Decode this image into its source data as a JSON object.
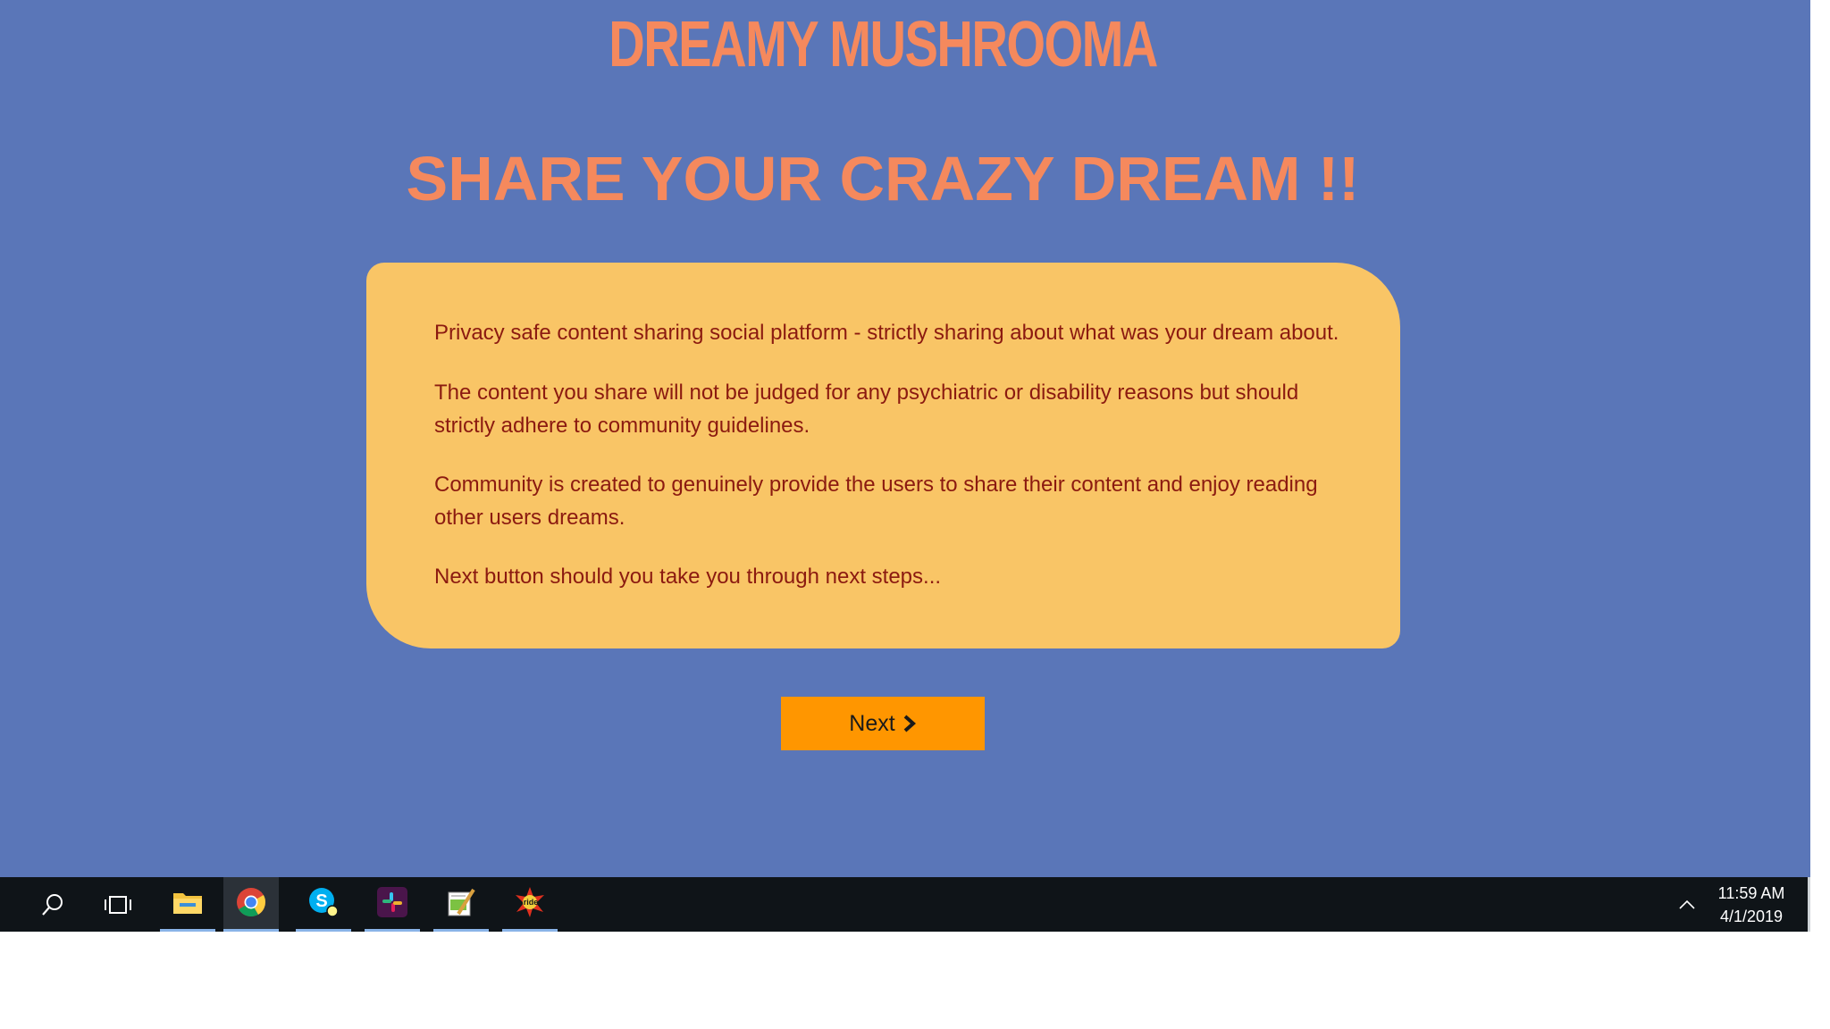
{
  "site": {
    "title": "DREAMY MUSHROOMA",
    "heading": "SHARE YOUR CRAZY DREAM !!"
  },
  "card": {
    "paragraphs": [
      "Privacy safe content sharing social platform - strictly sharing about what was your dream about.",
      "The content you share will not be judged for any psychiatric or disability reasons but should strictly adhere to community guidelines.",
      "Community is created to genuinely provide the users to share their content and enjoy reading other users dreams.",
      "Next button should you take you through next steps..."
    ]
  },
  "next_button": {
    "label": "Next",
    "icon": "chevron-right-icon"
  },
  "taskbar": {
    "time": "11:59 AM",
    "date": "4/1/2019",
    "apps": [
      {
        "name": "file-explorer",
        "icon": "folder-icon"
      },
      {
        "name": "chrome",
        "icon": "chrome-icon"
      },
      {
        "name": "skype",
        "icon": "skype-icon"
      },
      {
        "name": "slack",
        "icon": "slack-icon"
      },
      {
        "name": "notepad-plus",
        "icon": "notepad-icon"
      },
      {
        "name": "ride",
        "icon": "ride-icon"
      }
    ]
  },
  "colors": {
    "page_background": "#5a76b8",
    "title_color": "#f5895d",
    "card_background": "#f9c566",
    "card_text": "#8b1a10",
    "button_background": "#ff9600",
    "taskbar_background": "#0f1418"
  }
}
